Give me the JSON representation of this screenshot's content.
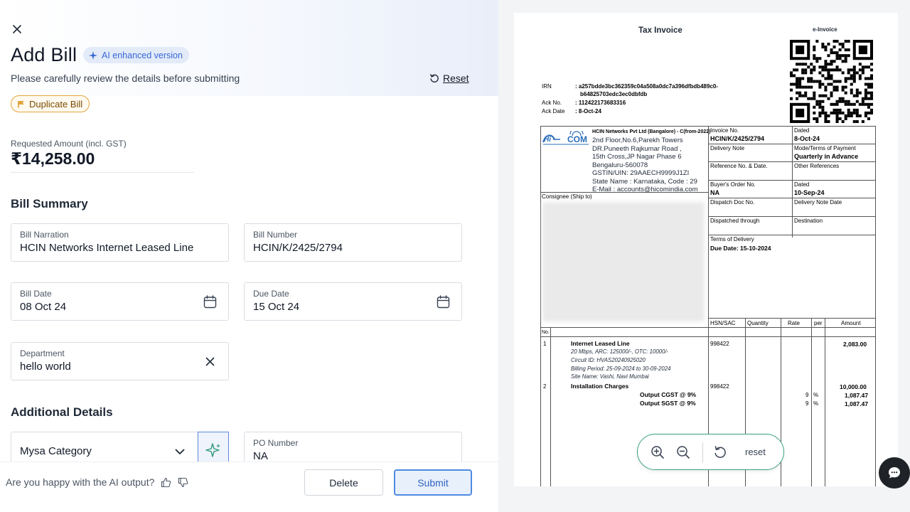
{
  "form": {
    "title": "Add Bill",
    "ai_badge": "AI enhanced version",
    "subtitle": "Please carefully review the details before submitting",
    "reset_label": "Reset",
    "duplicate_badge": "Duplicate Bill",
    "requested_amount_label": "Requested Amount (incl. GST)",
    "requested_amount": "₹14,258.00",
    "bill_summary_title": "Bill Summary",
    "fields": {
      "bill_narration": {
        "label": "Bill Narration",
        "value": "HCIN Networks Internet Leased Line"
      },
      "bill_number": {
        "label": "Bill Number",
        "value": "HCIN/K/2425/2794"
      },
      "bill_date": {
        "label": "Bill Date",
        "value": "08 Oct 24"
      },
      "due_date": {
        "label": "Due Date",
        "value": "15 Oct 24"
      },
      "department": {
        "label": "Department",
        "value": "hello world"
      },
      "po_number": {
        "label": "PO Number",
        "value": "NA"
      }
    },
    "additional_details_title": "Additional Details",
    "category_select": "Mysa Category"
  },
  "footer": {
    "feedback_text": "Are you happy with the AI output?",
    "delete_label": "Delete",
    "submit_label": "Submit"
  },
  "invoice": {
    "title": "Tax Invoice",
    "e_invoice": "e-Invoice",
    "irn_label": "IRN",
    "irn_value_1": ": a257bdde3bc362359c04a508a0dc7a396dfbdb489c0-",
    "irn_value_2": "b64825703edc3ec0dbfdb",
    "ack_no_label": "Ack No.",
    "ack_no_value": ": 112422173683316",
    "ack_date_label": "Ack Date",
    "ack_date_value": ": 8-Oct-24",
    "seller_name": "HCIN Networks Pvt Ltd (Bangalore) - C(from-2022)",
    "seller_lines": [
      "2nd Floor,No.6,Parekh Towers",
      "DR.Puneeth Rajkumar Road ,",
      "15th Cross,JP Nagar Phase 6",
      "Bengaluru-560078",
      "GSTIN/UIN: 29AAECH9999J1ZI",
      "State Name :  Karnataka, Code : 29",
      "E-Mail : accounts@hicomindia.com"
    ],
    "consignee": "Consignee (Ship to)",
    "invoice_no_label": "Invoice No.",
    "invoice_no": "HCIN/K/2425/2794",
    "dated_label": "Dated",
    "dated": "8-Oct-24",
    "delivery_note": "Delivery Note",
    "mode_terms_label": "Mode/Terms of Payment",
    "mode_terms": "Quarterly in Advance",
    "reference_label": "Reference No. & Date.",
    "other_ref_label": "Other References",
    "buyers_order_label": "Buyer's Order No.",
    "buyers_order": "NA",
    "dated2_label": "Dated",
    "dated2": "10-Sep-24",
    "dispatch_doc_label": "Dispatch Doc No.",
    "delivery_note_date_label": "Delivery Note Date",
    "dispatched_through_label": "Dispatched through",
    "destination_label": "Destination",
    "terms_delivery_label": "Terms of Delivery",
    "due_date": "Due Date: 15-10-2024",
    "col_hsn": "HSN/SAC",
    "col_qty": "Quantity",
    "col_rate": "Rate",
    "col_per": "per",
    "col_amount": "Amount",
    "col_no": "No.",
    "item1_no": "1",
    "item1_name": "Internet Leased Line",
    "item1_desc": [
      "20 Mbps, ARC: 125000/-, OTC: 10000/-",
      "Circuit ID: HVAS20240925020",
      "Billing Period: 25-09-2024 to 30-09-2024",
      "Site Name: Vashi, Navi Mumbai"
    ],
    "item1_hsn": "998422",
    "item1_amount": "2,083.00",
    "item2_no": "2",
    "item2_name": "Installation Charges",
    "item2_hsn": "998422",
    "item2_amount": "10,000.00",
    "cgst_label": "Output CGST @ 9%",
    "cgst_rate": "9",
    "cgst_per": "%",
    "cgst_amount": "1,087.47",
    "sgst_label": "Output SGST @ 9%",
    "sgst_rate": "9",
    "sgst_per": "%",
    "sgst_amount": "1,087.47"
  },
  "viewer": {
    "reset_label": "reset"
  },
  "colors": {
    "accent": "#3667d6",
    "warning": "#e2a53c",
    "zoom_border": "#3aa37e"
  }
}
